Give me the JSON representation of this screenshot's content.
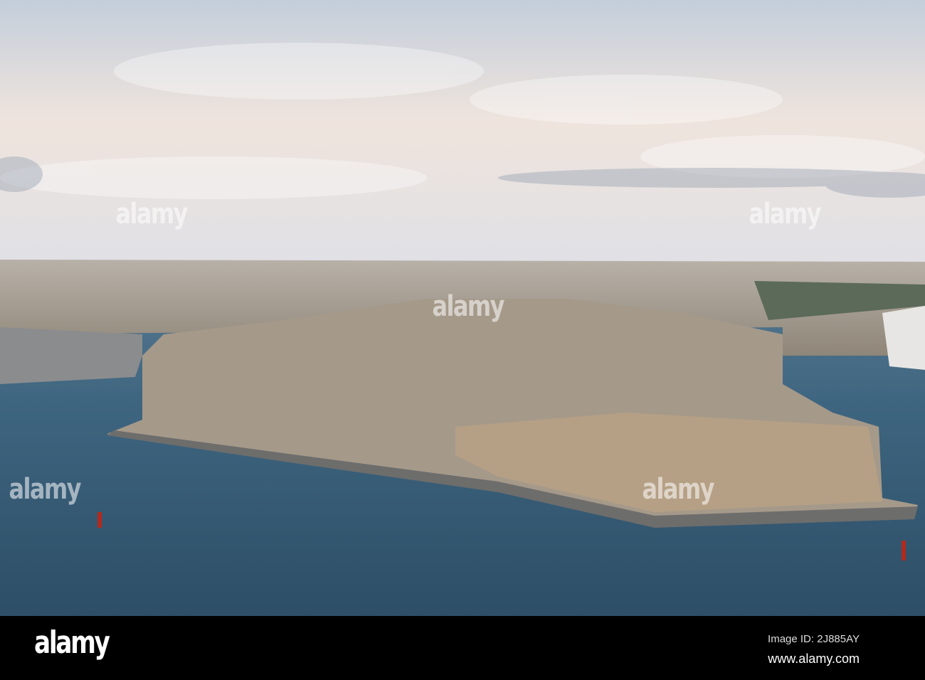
{
  "photo": {
    "subject": "Harbour town on fortified peninsula at dusk",
    "colors": {
      "sky_top": "#c6d0dc",
      "sky_glow": "#f3e6dc",
      "city": "#a59a8c",
      "fort": "#b59f84",
      "water": "#3f6680",
      "water_dark": "#2c4a60"
    }
  },
  "watermark": {
    "text": "alamy"
  },
  "footer": {
    "logo": "alamy",
    "image_id": "Image ID: 2J885AY",
    "website": "www.alamy.com"
  }
}
